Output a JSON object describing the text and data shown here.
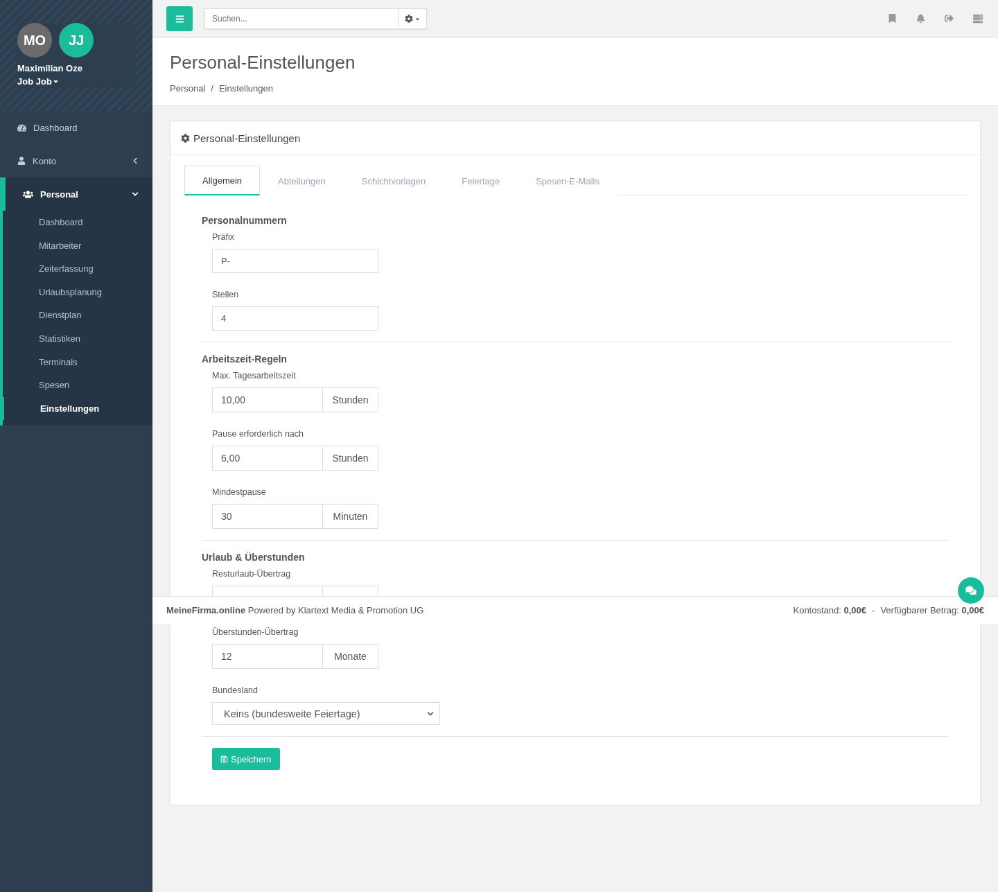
{
  "sidebar": {
    "user": {
      "avatars": [
        {
          "initials": "MO",
          "color": "#6b6b6b"
        },
        {
          "initials": "JJ",
          "color": "#1abc9c"
        }
      ],
      "name": "Maximilian Oze",
      "role": "Job Job"
    },
    "items": [
      {
        "label": "Dashboard",
        "kind": "gauge",
        "selected": false
      },
      {
        "label": "Konto",
        "kind": "user",
        "expanded": false,
        "selected": false,
        "has_children": true
      },
      {
        "label": "Personal",
        "kind": "users",
        "expanded": true,
        "selected": true,
        "has_children": true,
        "children": [
          {
            "label": "Dashboard",
            "selected": false
          },
          {
            "label": "Mitarbeiter",
            "selected": false
          },
          {
            "label": "Zeiterfassung",
            "selected": false
          },
          {
            "label": "Urlaubsplanung",
            "selected": false
          },
          {
            "label": "Dienstplan",
            "selected": false
          },
          {
            "label": "Statistiken",
            "selected": false
          },
          {
            "label": "Terminals",
            "selected": false
          },
          {
            "label": "Spesen",
            "selected": false
          },
          {
            "label": "Einstellungen",
            "selected": true
          }
        ]
      }
    ]
  },
  "topbar": {
    "search": {
      "placeholder": "Suchen..."
    }
  },
  "page": {
    "title": "Personal-Einstellungen",
    "breadcrumb": [
      "Personal",
      "Einstellungen"
    ],
    "breadcrumb_separator": "/"
  },
  "card": {
    "title": "Personal-Einstellungen",
    "tabs": [
      {
        "label": "Allgemein",
        "selected": true
      },
      {
        "label": "Abteilungen",
        "selected": false
      },
      {
        "label": "Schichtvorlagen",
        "selected": false
      },
      {
        "label": "Feiertage",
        "selected": false
      },
      {
        "label": "Spesen-E-Mails",
        "selected": false
      }
    ],
    "sections": [
      {
        "title": "Personalnummern",
        "fields": [
          {
            "kind": "text",
            "label": "Präfix",
            "value": "P-"
          },
          {
            "kind": "text",
            "label": "Stellen",
            "value": "4"
          }
        ]
      },
      {
        "title": "Arbeitszeit-Regeln",
        "fields": [
          {
            "kind": "addon",
            "label": "Max. Tagesarbeitszeit",
            "value": "10,00",
            "unit": "Stunden"
          },
          {
            "kind": "addon",
            "label": "Pause erforderlich nach",
            "value": "6,00",
            "unit": "Stunden"
          },
          {
            "kind": "addon",
            "label": "Mindestpause",
            "value": "30",
            "unit": "Minuten"
          }
        ]
      },
      {
        "title": "Urlaub & Überstunden",
        "fields": [
          {
            "kind": "addon",
            "label": "Resturlaub-Übertrag"
          },
          {
            "kind": "addon",
            "label": "Überstunden-Übertrag",
            "value": "12",
            "unit": "Monate"
          },
          {
            "kind": "select",
            "label": "Bundesland",
            "value": "Keins (bundesweite Feiertage)"
          }
        ]
      }
    ],
    "save": "Speichern"
  },
  "footer": {
    "credit": "**MeineFirma.online** Powered by Klartext Media & Promotion UG",
    "balance": "Kontostand: **0,00€**",
    "separator": "-",
    "available": "Verfügbarer Betrag: **0,00€**"
  }
}
